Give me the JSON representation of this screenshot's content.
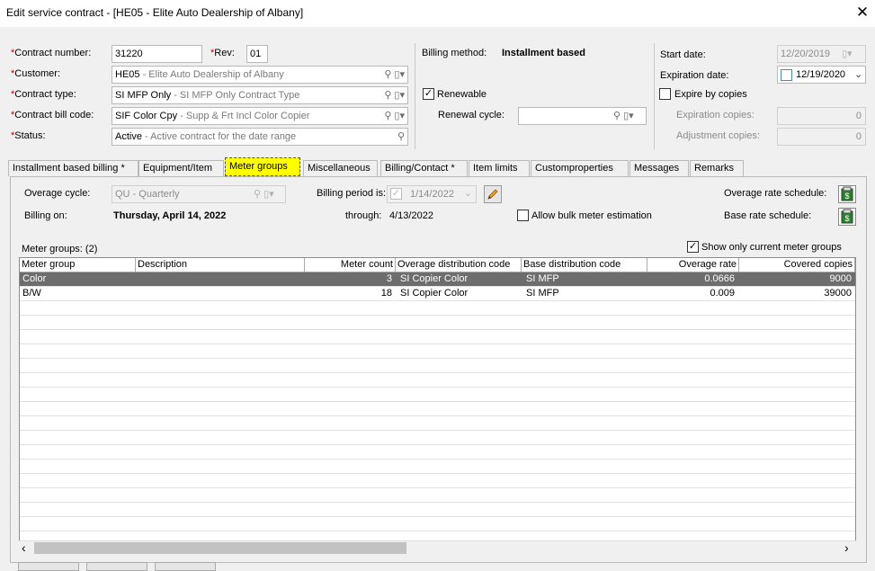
{
  "window": {
    "title": "Edit service contract - [HE05 - Elite Auto Dealership of Albany]",
    "close_glyph": "✕"
  },
  "form": {
    "contract_number": {
      "label": "Contract number:",
      "value": "31220"
    },
    "rev": {
      "label": "Rev:",
      "value": "01"
    },
    "customer": {
      "label": "Customer:",
      "code": "HE05",
      "desc": " - Elite Auto Dealership of Albany"
    },
    "contract_type": {
      "label": "Contract type:",
      "code": "SI MFP Only",
      "desc": " - SI MFP Only Contract Type"
    },
    "bill_code": {
      "label": "Contract bill code:",
      "code": "SIF Color Cpy",
      "desc": " - Supp & Frt Incl Color Copier"
    },
    "status": {
      "label": "Status:",
      "code": "Active",
      "desc": " - Active contract for the date range"
    },
    "required_mark": "*"
  },
  "billing": {
    "method_label": "Billing method:",
    "method_value": "Installment based",
    "renewable_label": "Renewable",
    "renewable_checked": true,
    "renewal_cycle_label": "Renewal cycle:",
    "renewal_cycle_value": ""
  },
  "dates": {
    "start_label": "Start date:",
    "start_value": "12/20/2019",
    "expiration_label": "Expiration date:",
    "expiration_value": "12/19/2020",
    "expire_by_copies_label": "Expire by copies",
    "expiration_copies_label": "Expiration copies:",
    "expiration_copies_value": "0",
    "adjustment_copies_label": "Adjustment copies:",
    "adjustment_copies_value": "0"
  },
  "tabs": [
    {
      "label": "Installment based billing *"
    },
    {
      "label": "Equipment/Item"
    },
    {
      "label": "Meter groups"
    },
    {
      "label": "Miscellaneous"
    },
    {
      "label": "Billing/Contact *"
    },
    {
      "label": "Item limits"
    },
    {
      "label": "Customproperties"
    },
    {
      "label": "Messages"
    },
    {
      "label": "Remarks"
    }
  ],
  "meter_tab": {
    "overage_cycle_label": "Overage cycle:",
    "overage_cycle_value": "QU - Quarterly",
    "billing_period_label": "Billing period is:",
    "billing_period_value": "1/14/2022",
    "overage_rate_schedule_label": "Overage rate schedule:",
    "billing_on_label": "Billing on:",
    "billing_on_value": "Thursday, April 14, 2022",
    "through_label": "through:",
    "through_value": "4/13/2022",
    "allow_bulk_label": "Allow bulk meter estimation",
    "base_rate_schedule_label": "Base rate schedule:",
    "meter_groups_count_label": "Meter groups: (2)",
    "show_current_label": "Show only current meter groups",
    "show_current_checked": true
  },
  "grid": {
    "columns": [
      "Meter group",
      "Description",
      "Meter count",
      "Overage distribution code",
      "Base distribution code",
      "Overage rate",
      "Covered copies"
    ],
    "rows": [
      [
        "Color",
        "",
        "3",
        "SI Copier Color",
        "SI MFP",
        "0.0666",
        "9000"
      ],
      [
        "B/W",
        "",
        "18",
        "SI Copier Color",
        "SI MFP",
        "0.009",
        "39000"
      ]
    ],
    "scroll_left": "‹",
    "scroll_right": "›"
  },
  "colors": {
    "active_tab": "#ffff00",
    "selected_row": "#6d6d6d",
    "required": "#c00000"
  }
}
